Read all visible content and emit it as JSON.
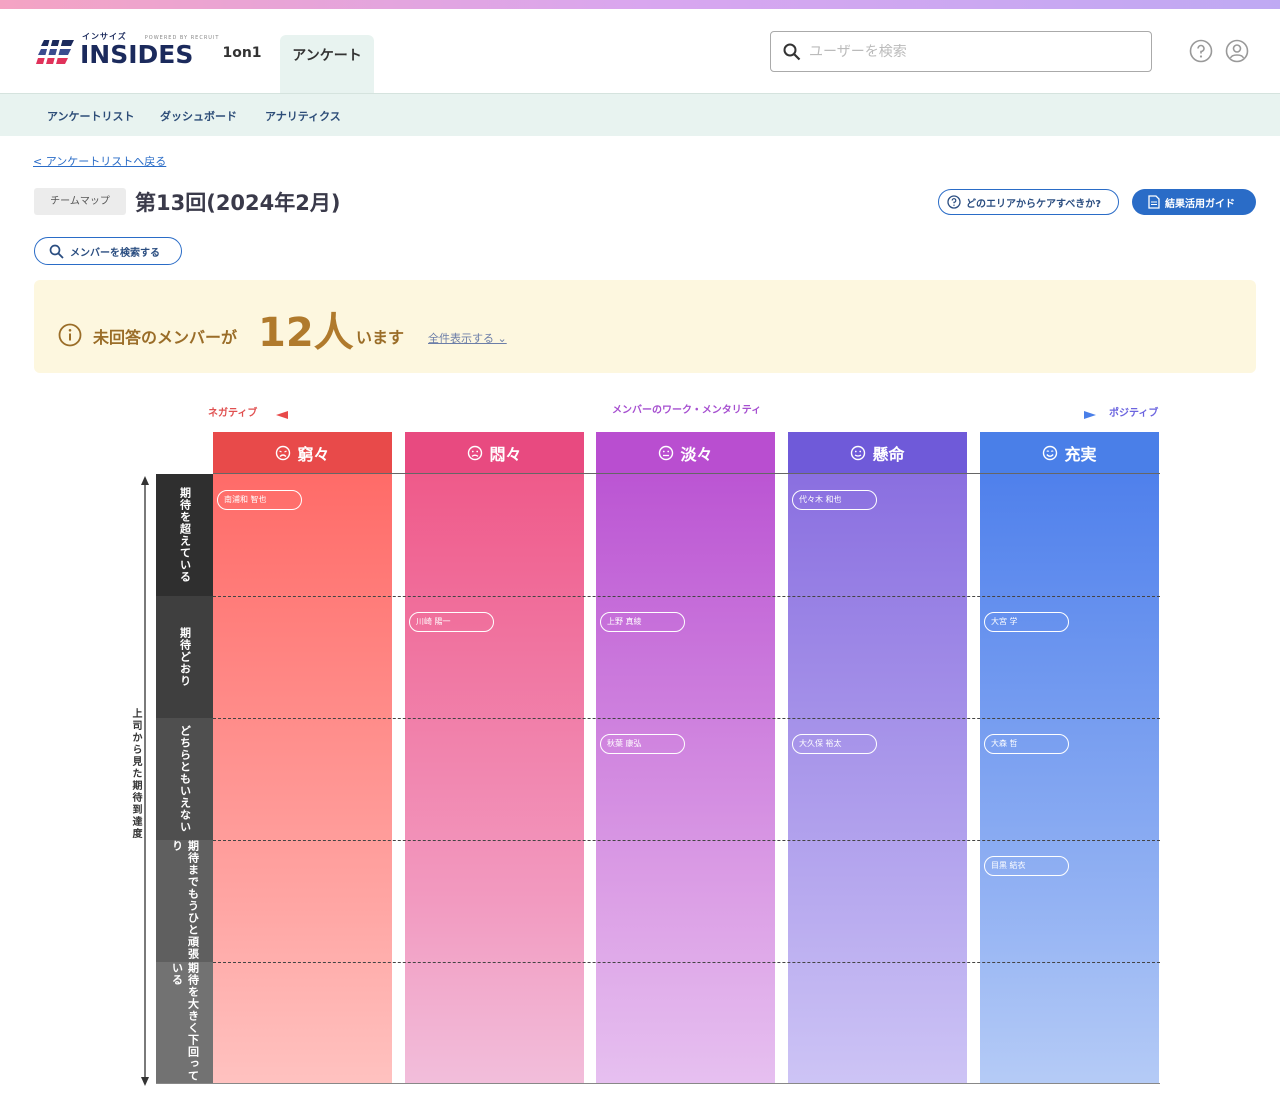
{
  "header": {
    "logo_small": "インサイズ",
    "logo_sub": "POWERED BY RECRUIT",
    "logo_big": "INSIDES",
    "tabs": [
      "1on1",
      "アンケート"
    ],
    "search_placeholder": "ユーザーを検索"
  },
  "subnav": [
    "アンケートリスト",
    "ダッシュボード",
    "アナリティクス"
  ],
  "back_link": "< アンケートリストへ戻る",
  "chip": "チームマップ",
  "title": "第13回(2024年2月)",
  "buttons": {
    "care_area": "どのエリアからケアすべきか?",
    "guide": "結果活用ガイド",
    "member_search": "メンバーを検索する"
  },
  "notice": {
    "prefix": "未回答のメンバーが",
    "count": "12人",
    "suffix": "います",
    "show_all": "全件表示する"
  },
  "map": {
    "axis_negative": "ネガティブ",
    "axis_positive": "ポジティブ",
    "axis_title": "メンバーのワーク・メンタリティ",
    "y_axis_title": "上司から見た期待到達度",
    "columns": [
      "窮々",
      "悶々",
      "淡々",
      "懸命",
      "充実"
    ],
    "column_colors": [
      "#e84a4a",
      "#e84a80",
      "#b94ed0",
      "#6f5ad9",
      "#4a7fe8"
    ],
    "rows": [
      "期待を超えている",
      "期待どおり",
      "どちらともいえない",
      "期待までもうひと頑張り",
      "期待を大きく下回っている"
    ],
    "members": [
      {
        "name": "南浦和 智也",
        "col": 0,
        "row": 0
      },
      {
        "name": "代々木 和也",
        "col": 3,
        "row": 0
      },
      {
        "name": "川崎 陽一",
        "col": 1,
        "row": 1
      },
      {
        "name": "上野 真綾",
        "col": 2,
        "row": 1
      },
      {
        "name": "大宮 学",
        "col": 4,
        "row": 1
      },
      {
        "name": "秋葉 康弘",
        "col": 2,
        "row": 2
      },
      {
        "name": "大久保 裕太",
        "col": 3,
        "row": 2
      },
      {
        "name": "大森 哲",
        "col": 4,
        "row": 2
      },
      {
        "name": "目黒 結衣",
        "col": 4,
        "row": 3
      }
    ]
  }
}
